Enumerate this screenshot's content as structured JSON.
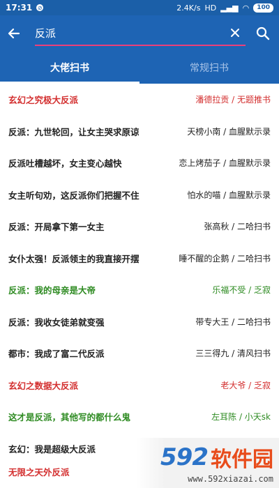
{
  "status_bar": {
    "time": "17:31",
    "network_speed": "2.4K/s",
    "network_type": "HD",
    "battery": "100"
  },
  "search": {
    "value": "反派"
  },
  "tabs": [
    {
      "label": "大佬扫书",
      "active": true
    },
    {
      "label": "常规扫书",
      "active": false
    }
  ],
  "colors": {
    "primary": "#1e64b4",
    "search_underline": "#ec407a",
    "highlight_red": "#d32f2f",
    "highlight_green": "#2e8b22"
  },
  "books": [
    {
      "title": "玄幻之究极大反派",
      "meta": "潘德拉贡 / 无题推书",
      "color": "red"
    },
    {
      "title": "反派：九世轮回，让女主哭求原谅",
      "meta": "天榜小南 / 血腥默示录",
      "color": "normal"
    },
    {
      "title": "反派吐槽越坏，女主变心越快",
      "meta": "恋上烤茄子 / 血腥默示录",
      "color": "normal"
    },
    {
      "title": "女主听句劝，这反派你们把握不住",
      "meta": "怕水的喵 / 血腥默示录",
      "color": "normal"
    },
    {
      "title": "反派：开局拿下第一女主",
      "meta": "张高秋 / 二哈扫书",
      "color": "normal"
    },
    {
      "title": "女仆太强！反派领主的我直接开摆",
      "meta": "睡不醒的企鹅 / 二哈扫书",
      "color": "normal"
    },
    {
      "title": "反派：我的母亲是大帝",
      "meta": "乐福不受 / 乏寂",
      "color": "green"
    },
    {
      "title": "反派：我收女徒弟就变强",
      "meta": "带专大王 / 二哈扫书",
      "color": "normal"
    },
    {
      "title": "都市：我成了富二代反派",
      "meta": "三三得九 / 清风扫书",
      "color": "normal"
    },
    {
      "title": "玄幻之数据大反派",
      "meta": "老大爷 / 乏寂",
      "color": "red"
    },
    {
      "title": "这才是反派，其他写的都什么鬼",
      "meta": "左耳陈 / 小天sk",
      "color": "green"
    },
    {
      "title": "玄幻：我是超级大反派",
      "meta": "",
      "color": "normal"
    },
    {
      "title": "无限之天外反派",
      "meta": "",
      "color": "red"
    }
  ],
  "watermark": {
    "number": "592",
    "text": "软件园",
    "url": "www.592xiazai.com"
  }
}
